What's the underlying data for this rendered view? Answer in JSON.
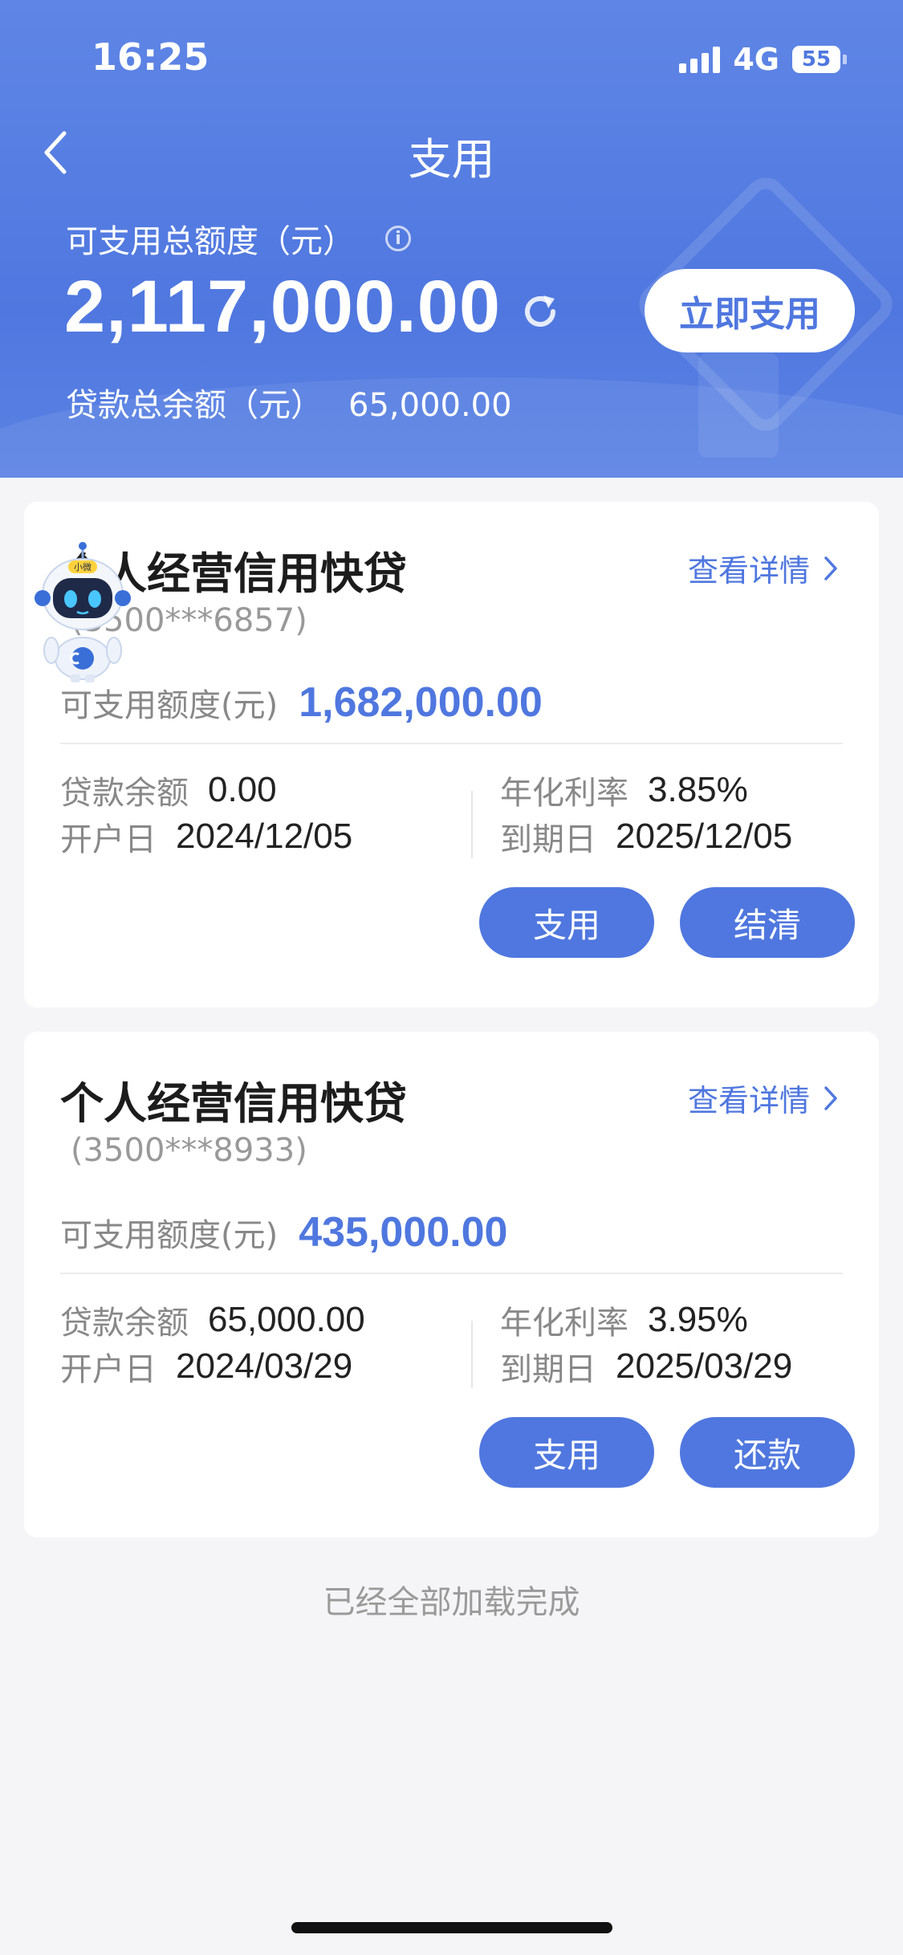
{
  "status_bar": {
    "time": "16:25",
    "network": "4G",
    "battery": "55"
  },
  "nav": {
    "title": "支用"
  },
  "summary": {
    "total_label": "可支用总额度（元）",
    "total_amount": "2,117,000.00",
    "use_now_label": "立即支用",
    "loan_balance_label": "贷款总余额（元）",
    "loan_balance_value": "65,000.00"
  },
  "cards": [
    {
      "title": "个人经营信用快贷",
      "account": "(3500***6857)",
      "detail_link": "查看详情",
      "avail_label": "可支用额度(元)",
      "avail_value": "1,682,000.00",
      "balance_label": "贷款余额",
      "balance_value": "0.00",
      "open_label": "开户日",
      "open_value": "2024/12/05",
      "rate_label": "年化利率",
      "rate_value": "3.85%",
      "due_label": "到期日",
      "due_value": "2025/12/05",
      "btn1": "支用",
      "btn2": "结清"
    },
    {
      "title": "个人经营信用快贷",
      "account": "(3500***8933)",
      "detail_link": "查看详情",
      "avail_label": "可支用额度(元)",
      "avail_value": "435,000.00",
      "balance_label": "贷款余额",
      "balance_value": "65,000.00",
      "open_label": "开户日",
      "open_value": "2024/03/29",
      "rate_label": "年化利率",
      "rate_value": "3.95%",
      "due_label": "到期日",
      "due_value": "2025/03/29",
      "btn1": "支用",
      "btn2": "还款"
    }
  ],
  "robot": {
    "badge": "小微"
  },
  "footer": {
    "loaded_text": "已经全部加载完成"
  },
  "colors": {
    "primary": "#4f77df",
    "header_bg": "#5a80e3",
    "page_bg": "#f5f5f7"
  }
}
